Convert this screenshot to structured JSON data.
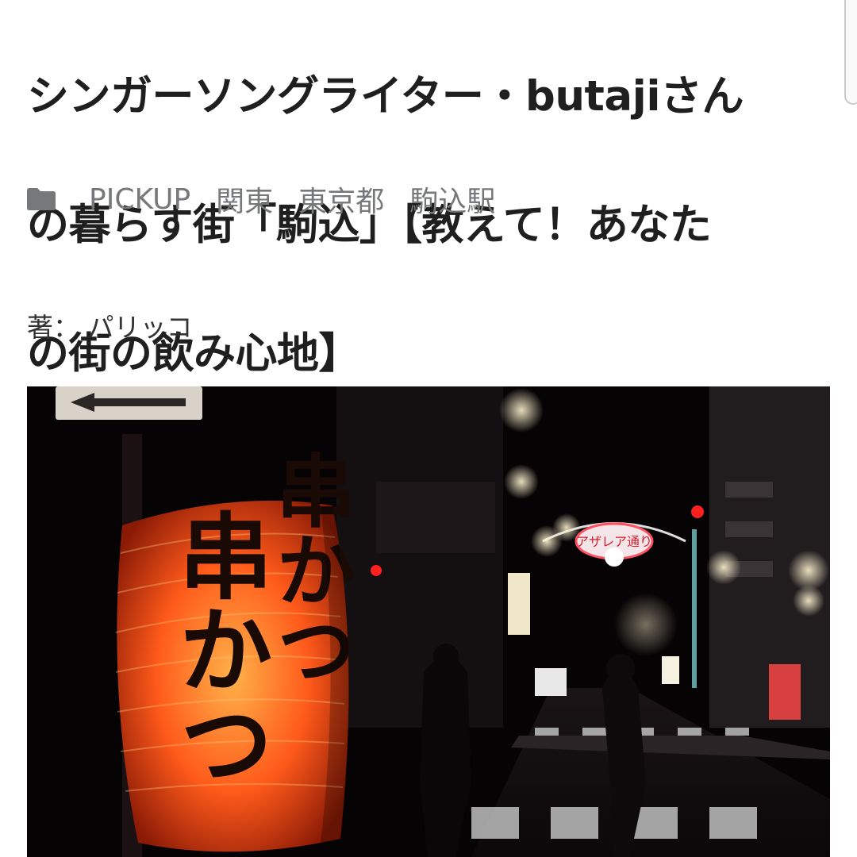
{
  "article": {
    "title_lines": [
      "シンガーソングライター・butajiさん",
      "の暮らす街「駒込」【教えて！あなた",
      "の街の飲み心地】"
    ],
    "categories": [
      "PICKUP",
      "関東",
      "東京都",
      "駒込駅"
    ],
    "category_icon": "folder-icon",
    "author": "著： パリッコ"
  },
  "photo": {
    "lantern_text": [
      "串かつ",
      "串かつ"
    ],
    "arch_sign": "アザレア通り",
    "colors": {
      "lantern": "#ff5a1a",
      "sky": "#060304",
      "traffic_light": "#ff2020"
    }
  }
}
